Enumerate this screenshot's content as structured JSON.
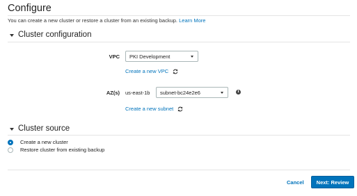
{
  "page": {
    "title": "Configure",
    "intro_text": "You can create a new cluster or restore a cluster from an existing backup.",
    "learn_more": "Learn More"
  },
  "cluster_configuration": {
    "header": "Cluster configuration",
    "vpc_label": "VPC",
    "vpc_value": "PKI Development",
    "create_vpc_link": "Create a new VPC",
    "az_label": "AZ(s)",
    "az_value": "us-east-1b",
    "subnet_value": "subnet-bc24e2e6",
    "create_subnet_link": "Create a new subnet",
    "info_glyph": "i"
  },
  "cluster_source": {
    "header": "Cluster source",
    "options": [
      {
        "label": "Create a new cluster",
        "selected": true
      },
      {
        "label": "Restore cluster from existing backup",
        "selected": false
      }
    ]
  },
  "footer": {
    "cancel_label": "Cancel",
    "next_label": "Next: Review"
  },
  "colors": {
    "accent": "#0073bb",
    "rule": "#e4e4e4"
  },
  "icons": {
    "refresh": "refresh-icon",
    "info": "info-icon",
    "caret": "caret-down-icon"
  }
}
